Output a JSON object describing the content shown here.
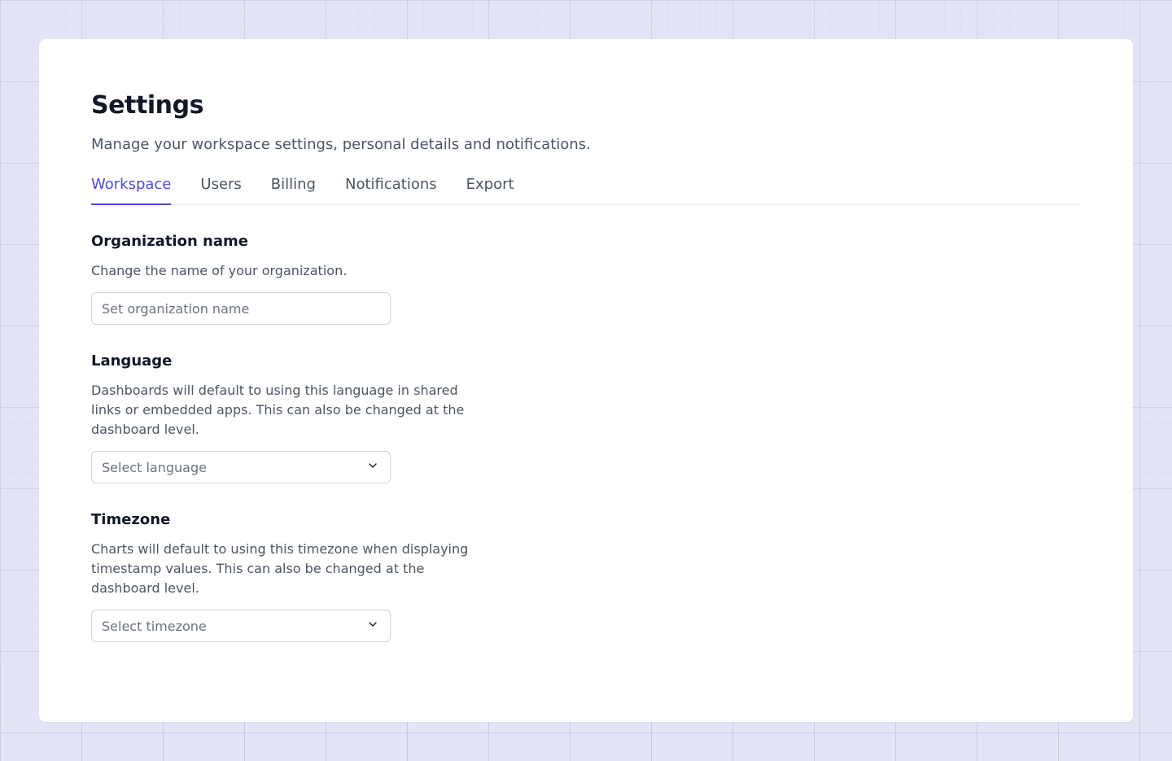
{
  "header": {
    "title": "Settings",
    "subtitle": "Manage your workspace settings, personal details and notifications."
  },
  "tabs": [
    {
      "label": "Workspace",
      "active": true
    },
    {
      "label": "Users",
      "active": false
    },
    {
      "label": "Billing",
      "active": false
    },
    {
      "label": "Notifications",
      "active": false
    },
    {
      "label": "Export",
      "active": false
    }
  ],
  "sections": {
    "org": {
      "title": "Organization name",
      "description": "Change the name of your organization.",
      "placeholder": "Set organization name",
      "value": ""
    },
    "language": {
      "title": "Language",
      "description": "Dashboards will default to using this language in shared links or embedded apps. This can also be changed at the dashboard level.",
      "placeholder": "Select language"
    },
    "timezone": {
      "title": "Timezone",
      "description": "Charts will default to using this timezone when displaying timestamp values. This can also be changed at the dashboard level.",
      "placeholder": "Select timezone"
    }
  }
}
